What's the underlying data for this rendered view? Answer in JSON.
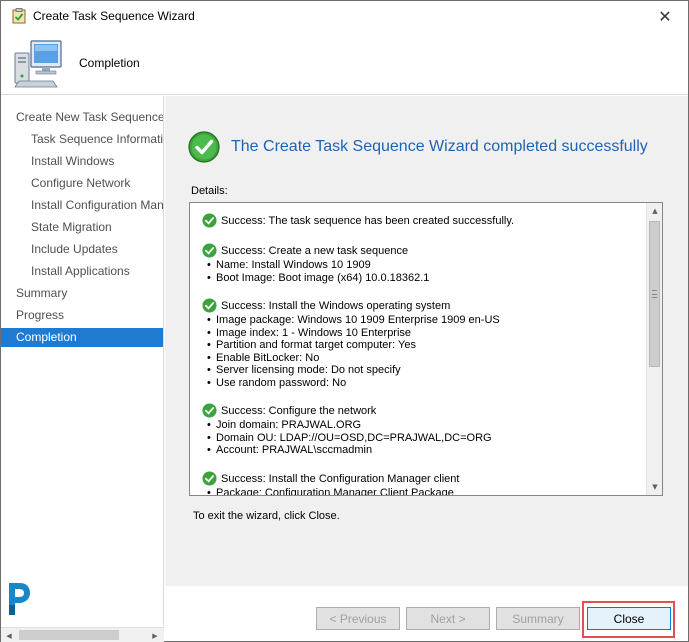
{
  "window": {
    "title": "Create Task Sequence Wizard",
    "close_glyph": "✕"
  },
  "header": {
    "title": "Completion",
    "icon": "computer-icon"
  },
  "nav": {
    "items": [
      {
        "label": "Create New Task Sequence",
        "level": 0,
        "active": false
      },
      {
        "label": "Task Sequence Information",
        "level": 1,
        "active": false
      },
      {
        "label": "Install Windows",
        "level": 1,
        "active": false
      },
      {
        "label": "Configure Network",
        "level": 1,
        "active": false
      },
      {
        "label": "Install Configuration Manager",
        "level": 1,
        "active": false
      },
      {
        "label": "State Migration",
        "level": 1,
        "active": false
      },
      {
        "label": "Include Updates",
        "level": 1,
        "active": false
      },
      {
        "label": "Install Applications",
        "level": 1,
        "active": false
      },
      {
        "label": "Summary",
        "level": 0,
        "active": false
      },
      {
        "label": "Progress",
        "level": 0,
        "active": false
      },
      {
        "label": "Completion",
        "level": 0,
        "active": true
      }
    ]
  },
  "main": {
    "heading": "The Create Task Sequence Wizard completed successfully",
    "details_label": "Details:",
    "exit_text": "To exit the wizard, click Close.",
    "entries": [
      {
        "head": "Success: The task sequence has been created successfully.",
        "bullets": []
      },
      {
        "head": "Success: Create a new task sequence",
        "bullets": [
          "Name: Install Windows 10 1909",
          "Boot Image: Boot image (x64) 10.0.18362.1"
        ]
      },
      {
        "head": "Success: Install the Windows operating system",
        "bullets": [
          "Image package: Windows 10 1909 Enterprise 1909 en-US",
          "Image index: 1 - Windows 10 Enterprise",
          "Partition and format target computer: Yes",
          "Enable BitLocker: No",
          "Server licensing mode: Do not specify",
          "Use random password: No"
        ]
      },
      {
        "head": "Success: Configure the network",
        "bullets": [
          "Join domain: PRAJWAL.ORG",
          "Domain OU: LDAP://OU=OSD,DC=PRAJWAL,DC=ORG",
          "Account: PRAJWAL\\sccmadmin"
        ]
      },
      {
        "head": "Success: Install the Configuration Manager client",
        "bullets": [
          "Package: Configuration Manager Client Package"
        ]
      }
    ]
  },
  "footer": {
    "previous_label": "< Previous",
    "next_label": "Next >",
    "summary_label": "Summary",
    "close_label": "Close"
  },
  "colors": {
    "accent": "#1e7bd1",
    "heading": "#1e64b4",
    "success": "#2f9e2f",
    "highlight": "#e0524f"
  }
}
